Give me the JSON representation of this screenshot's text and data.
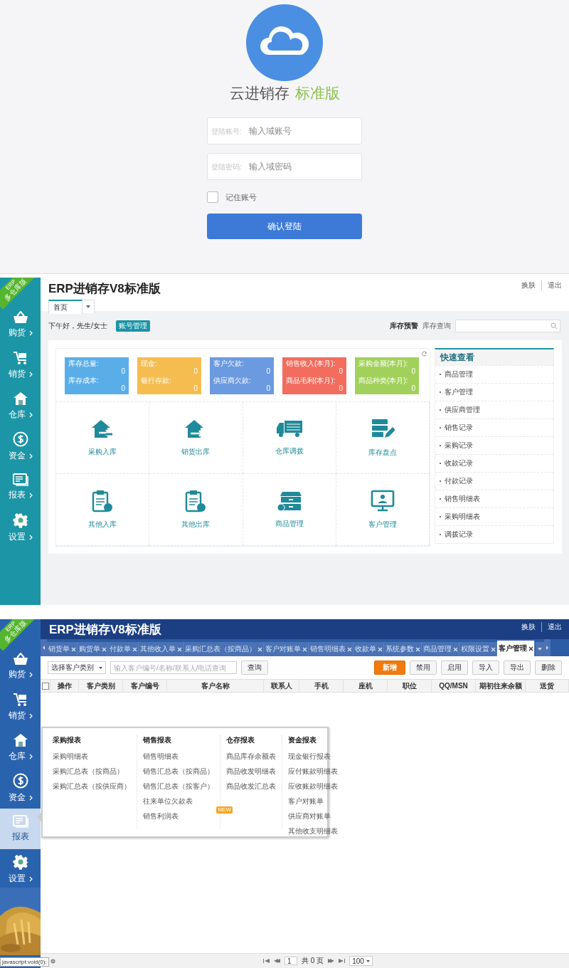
{
  "login": {
    "app_name": "云进销存",
    "edition": "标准版",
    "fields": [
      {
        "label": "登陆账号:",
        "placeholder": "输入域账号"
      },
      {
        "label": "登陆密码:",
        "placeholder": "输入域密码"
      }
    ],
    "remember": {
      "label": "记住账号",
      "checked": false
    },
    "submit": "确认登陆"
  },
  "dashboard": {
    "sidebar": {
      "ribbon": {
        "small": "ERP",
        "label": "多仓库版"
      },
      "items": [
        {
          "label": "购货",
          "selected": false
        },
        {
          "label": "销货",
          "selected": false
        },
        {
          "label": "仓库",
          "selected": false
        },
        {
          "label": "资金",
          "selected": false
        },
        {
          "label": "报表",
          "selected": false
        },
        {
          "label": "设置",
          "selected": false
        }
      ]
    },
    "title": "ERP进销存V8标准版",
    "header_links": [
      "换肤",
      "退出"
    ],
    "tabs": [
      {
        "label": "首页",
        "selected": true
      }
    ],
    "greeting": "下午好，先生/女士",
    "account_badge": "账号管理",
    "stock_alert": "库存预警",
    "stock_query": "库存查询",
    "stats": [
      {
        "color": "#5aaee8",
        "lines": [
          {
            "label": "库存总量:",
            "value": "0"
          },
          {
            "label": "库存成本:",
            "value": "0"
          }
        ]
      },
      {
        "color": "#f5bd50",
        "lines": [
          {
            "label": "现金:",
            "value": "0"
          },
          {
            "label": "银行存款:",
            "value": "0"
          }
        ]
      },
      {
        "color": "#6b9ae0",
        "lines": [
          {
            "label": "客户欠款:",
            "value": "0"
          },
          {
            "label": "供应商欠款:",
            "value": "0"
          }
        ]
      },
      {
        "color": "#f26d5e",
        "lines": [
          {
            "label": "销售收入(本月):",
            "value": "0"
          },
          {
            "label": "商品毛利(本月):",
            "value": "0"
          }
        ]
      },
      {
        "color": "#a2d15b",
        "lines": [
          {
            "label": "采购金额(本月):",
            "value": "0"
          },
          {
            "label": "商品种类(本月):",
            "value": "0"
          }
        ]
      }
    ],
    "shortcuts": [
      "采购入库",
      "销货出库",
      "仓库调拨",
      "库存盘点",
      "其他入库",
      "其他出库",
      "商品管理",
      "客户管理"
    ],
    "quick_view": {
      "title": "快速查看",
      "items": [
        "商品管理",
        "客户管理",
        "供应商管理",
        "销售记录",
        "采购记录",
        "收款记录",
        "付款记录",
        "销售明细表",
        "采购明细表",
        "调拨记录"
      ]
    }
  },
  "customers": {
    "sidebar": {
      "ribbon": {
        "small": "ERP",
        "label": "多仓库版"
      },
      "items": [
        {
          "label": "购货",
          "selected": false
        },
        {
          "label": "销货",
          "selected": false
        },
        {
          "label": "仓库",
          "selected": false
        },
        {
          "label": "资金",
          "selected": false
        },
        {
          "label": "报表",
          "selected": true
        },
        {
          "label": "设置",
          "selected": false
        }
      ]
    },
    "title": "ERP进销存V8标准版",
    "header_links": [
      "换肤",
      "退出"
    ],
    "tabs": [
      {
        "label": "销货单",
        "selected": false
      },
      {
        "label": "购货单",
        "selected": false
      },
      {
        "label": "付款单",
        "selected": false
      },
      {
        "label": "其他收入单",
        "selected": false
      },
      {
        "label": "采购汇总表（按商品）",
        "selected": false
      },
      {
        "label": "客户对账单",
        "selected": false
      },
      {
        "label": "销售明细表",
        "selected": false
      },
      {
        "label": "收款单",
        "selected": false
      },
      {
        "label": "系统参数",
        "selected": false
      },
      {
        "label": "商品管理",
        "selected": false
      },
      {
        "label": "权限设置",
        "selected": false
      },
      {
        "label": "客户管理",
        "selected": true
      }
    ],
    "category_select": "选择客户类别",
    "search_placeholder": "输入客户编号/名称/联系人/电话查询",
    "search_button": "查询",
    "actions": [
      {
        "label": "新增",
        "kind": "primary"
      },
      {
        "label": "禁用",
        "kind": "normal"
      },
      {
        "label": "启用",
        "kind": "normal"
      },
      {
        "label": "导入",
        "kind": "normal"
      },
      {
        "label": "导出",
        "kind": "normal"
      },
      {
        "label": "删除",
        "kind": "normal"
      }
    ],
    "select_all": {
      "checked": false
    },
    "columns": [
      "操作",
      "客户类别",
      "客户编号",
      "客户名称",
      "联系人",
      "手机",
      "座机",
      "职位",
      "QQ/MSN",
      "期初往来余额",
      "送货"
    ],
    "reports_menu": [
      {
        "title": "采购报表",
        "items": [
          {
            "label": "采购明细表"
          },
          {
            "label": "采购汇总表（按商品）"
          },
          {
            "label": "采购汇总表（按供应商）"
          }
        ]
      },
      {
        "title": "销售报表",
        "items": [
          {
            "label": "销售明细表"
          },
          {
            "label": "销售汇总表（按商品）"
          },
          {
            "label": "销售汇总表（按客户）"
          },
          {
            "label": "往来单位欠款表"
          },
          {
            "label": "销售利润表",
            "badge": "NEW"
          }
        ]
      },
      {
        "title": "仓存报表",
        "items": [
          {
            "label": "商品库存余额表"
          },
          {
            "label": "商品收发明细表"
          },
          {
            "label": "商品收发汇总表"
          }
        ]
      },
      {
        "title": "资金报表",
        "items": [
          {
            "label": "现金银行报表"
          },
          {
            "label": "应付账款明细表"
          },
          {
            "label": "应收账款明细表"
          },
          {
            "label": "客户对账单"
          },
          {
            "label": "供应商对账单"
          },
          {
            "label": "其他收支明细表"
          }
        ]
      }
    ],
    "pager": {
      "page": "1",
      "total": "共 0 页",
      "page_size": "100"
    },
    "status_tooltip": "javascript:void(0);"
  }
}
